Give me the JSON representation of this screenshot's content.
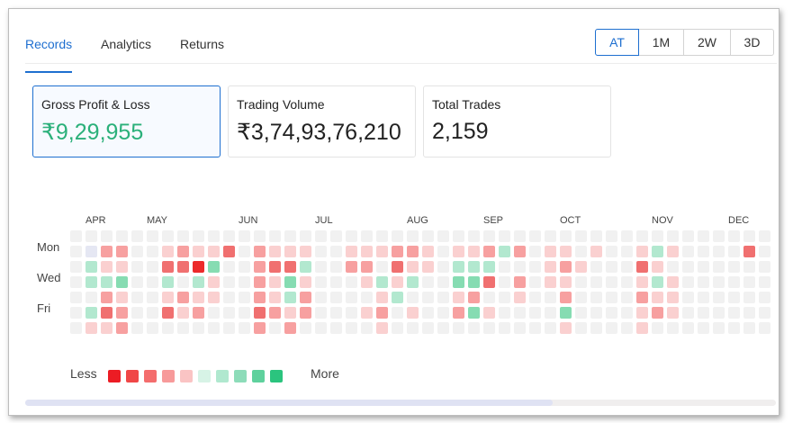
{
  "tabs": [
    {
      "label": "Records",
      "active": true
    },
    {
      "label": "Analytics",
      "active": false
    },
    {
      "label": "Returns",
      "active": false
    }
  ],
  "range_buttons": [
    {
      "label": "AT",
      "active": true
    },
    {
      "label": "1M",
      "active": false
    },
    {
      "label": "2W",
      "active": false
    },
    {
      "label": "3D",
      "active": false
    }
  ],
  "cards": [
    {
      "label": "Gross Profit & Loss",
      "value": "₹9,29,955",
      "active": true,
      "positive": true
    },
    {
      "label": "Trading Volume",
      "value": "₹3,74,93,76,210",
      "active": false,
      "positive": false
    },
    {
      "label": "Total Trades",
      "value": "2,159",
      "active": false,
      "positive": false
    }
  ],
  "heatmap": {
    "months": [
      "APR",
      "MAY",
      "JUN",
      "JUL",
      "AUG",
      "SEP",
      "OCT",
      "NOV",
      "DEC"
    ],
    "day_labels": [
      "Mon",
      "Wed",
      "Fri"
    ],
    "legend": {
      "less": "Less",
      "more": "More",
      "colors": [
        "#ec1c24",
        "#f04747",
        "#f46d6d",
        "#f79a9a",
        "#fac4c4",
        "#d7f3e6",
        "#b0e8cf",
        "#8ddcb9",
        "#5fd19d",
        "#2bc47e"
      ]
    },
    "colors": {
      "0": "#f1f1f1",
      "1": "#fad0d0",
      "2": "#f7a0a0",
      "3": "#f07070",
      "4": "#ec2b2b",
      "5": "#b2e8cf",
      "6": "#86dcb2",
      "7": "#4fcf8d",
      "8": "#2bbd70",
      "9": "#e5e7f3"
    },
    "columns": [
      "0000000",
      "0955051",
      "0215231",
      "0216122",
      "0000000",
      "0000000",
      "0135130",
      "0230210",
      "0145120",
      "0161100",
      "0300000",
      "0000000",
      "0222232",
      "0131120",
      "0136512",
      "0151220",
      "0000000",
      "0000000",
      "0120000",
      "0121010",
      "0105121",
      "0231500",
      "0215010",
      "0110000",
      "0000000",
      "0156120",
      "0156260",
      "0253010",
      "0500000",
      "0202100",
      "0000000",
      "0111000",
      "0121261",
      "0010000",
      "0100000",
      "0000000",
      "0000000",
      "0131211",
      "0515120",
      "0101110",
      "0000000",
      "0000000",
      "0000000",
      "0000000",
      "0300000",
      "0000000",
      "0000000",
      "0000000",
      "0000000",
      "0000000"
    ]
  }
}
